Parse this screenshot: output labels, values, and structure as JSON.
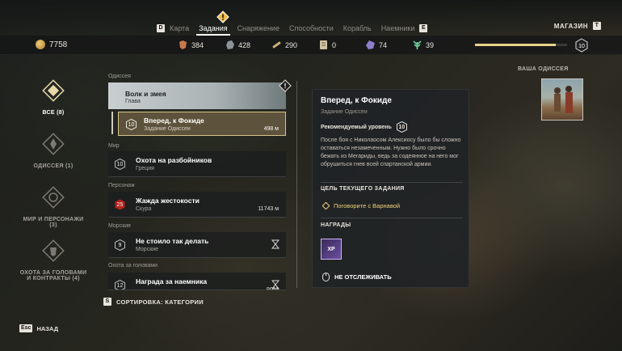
{
  "top_tabs": {
    "left_key": "D",
    "right_key": "E",
    "items": [
      {
        "label": "Карта",
        "active": false
      },
      {
        "label": "Задания",
        "active": true
      },
      {
        "label": "Снаряжение",
        "active": false
      },
      {
        "label": "Способности",
        "active": false
      },
      {
        "label": "Корабль",
        "active": false
      },
      {
        "label": "Наемники",
        "active": false
      }
    ]
  },
  "shop": {
    "label": "МАГАЗИН",
    "key": "T"
  },
  "resources": {
    "drachmae": "7758",
    "items": [
      {
        "icon": "leather-icon",
        "value": "384"
      },
      {
        "icon": "iron-ore-icon",
        "value": "428"
      },
      {
        "icon": "wood-icon",
        "value": "290"
      },
      {
        "icon": "ancient-tablet-icon",
        "value": "0"
      },
      {
        "icon": "obsidian-icon",
        "value": "74"
      },
      {
        "icon": "olive-branch-icon",
        "value": "39"
      }
    ],
    "level": "10",
    "xp_progress": 0.88
  },
  "categories": [
    {
      "label": "ВСЕ (8)",
      "active": true,
      "icon": "all-quests-icon"
    },
    {
      "label": "ОДИССЕЯ (1)",
      "active": false,
      "icon": "odyssey-icon"
    },
    {
      "label": "МИР И ПЕРСОНАЖИ (3)",
      "active": false,
      "icon": "world-icon"
    },
    {
      "label": "ОХОТА ЗА ГОЛОВАМИ И КОНТРАКТЫ (4)",
      "active": false,
      "icon": "bounty-icon"
    }
  ],
  "quest_list": {
    "sec_odyssey": "Одиссея",
    "chapter": {
      "title": "Волк и змея",
      "subtitle": "Глава"
    },
    "selected": {
      "level": "10",
      "title": "Вперед, к Фокиде",
      "subtitle": "Задание Одиссеи",
      "distance": "498 м"
    },
    "sec_world": "Мир",
    "world": {
      "level": "10",
      "title": "Охота на разбойников",
      "subtitle": "Греция"
    },
    "sec_characters": "Персонаж",
    "characters": {
      "level": "25",
      "title": "Жажда жестокости",
      "subtitle": "Скура",
      "distance": "11743 м"
    },
    "sec_sea": "Морские",
    "sea": {
      "level": "9",
      "title": "Не стоило так делать",
      "subtitle": "Морские"
    },
    "sec_bounty": "Охота за головами",
    "bounty": {
      "level": "12",
      "title": "Награда за наемника",
      "subtitle": "",
      "distance": "9011"
    }
  },
  "sort": {
    "key": "S",
    "label": "СОРТИРОВКА: КАТЕГОРИИ"
  },
  "back": {
    "key": "Esc",
    "label": "НАЗАД"
  },
  "detail": {
    "title": "Вперед, к Фокиде",
    "subtitle": "Задание Одиссеи",
    "recommended_label": "Рекомендуемый уровень",
    "recommended_level": "10",
    "description": "После боя с Николаосом Алексиосу было бы сложно оставаться незамеченным. Нужно было срочно бежать из Мегариды, ведь за содеянное на него мог обрушиться гнев всей спартанской армии.",
    "objective_header": "ЦЕЛЬ ТЕКУЩЕГО ЗАДАНИЯ",
    "objective": "Поговорите с Варнавой",
    "rewards_header": "НАГРАДЫ",
    "reward_xp": "XP",
    "untrack": "НЕ ОТСЛЕЖИВАТЬ"
  },
  "odyssey": {
    "label": "ВАША ОДИССЕЯ"
  }
}
